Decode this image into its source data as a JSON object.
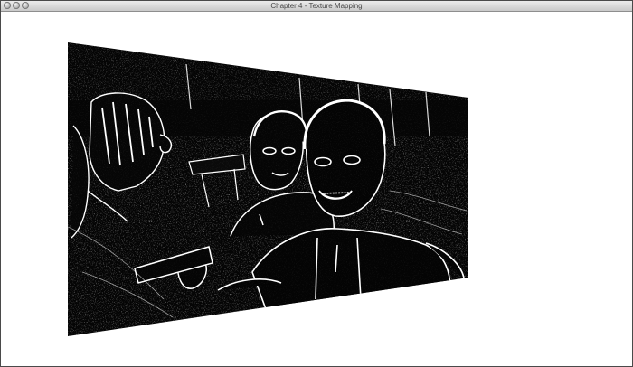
{
  "window": {
    "title": "Chapter 4 - Texture Mapping"
  },
  "colors": {
    "background": "#ffffff",
    "texture_dark": "#050505",
    "texture_edge": "#ffffff",
    "titlebar": "#d8d8d8"
  },
  "icons": [
    "close-icon",
    "minimize-icon",
    "zoom-icon"
  ]
}
